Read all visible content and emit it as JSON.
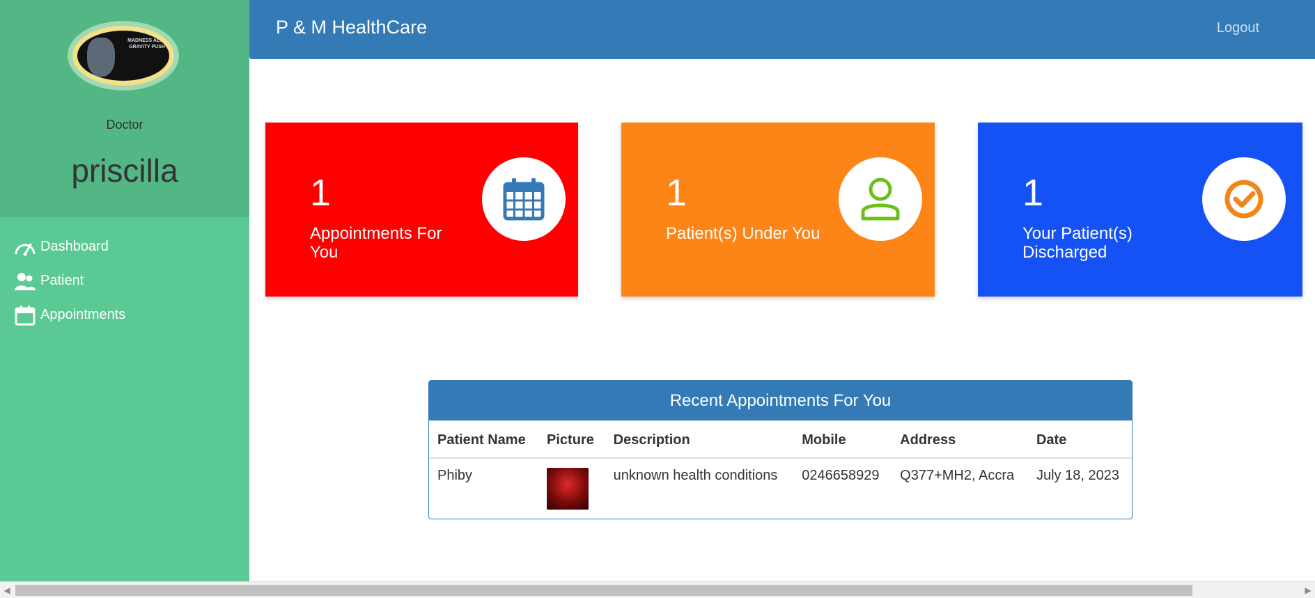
{
  "sidebar": {
    "role": "Doctor",
    "username": "priscilla",
    "avatar_text": "MADNESS ALOT GRAVITY PUSH",
    "items": [
      {
        "label": "Dashboard",
        "icon": "speedometer-icon"
      },
      {
        "label": "Patient",
        "icon": "users-icon"
      },
      {
        "label": "Appointments",
        "icon": "calendar-icon"
      }
    ]
  },
  "header": {
    "brand": "P & M HealthCare",
    "logout": "Logout"
  },
  "cards": [
    {
      "count": "1",
      "label": "Appointments For You",
      "color": "#ff0000",
      "icon": "calendar-icon",
      "icon_color": "#337ab7"
    },
    {
      "count": "1",
      "label": "Patient(s) Under You",
      "color": "#fd8416",
      "icon": "user-icon",
      "icon_color": "#6abf1a"
    },
    {
      "count": "1",
      "label": "Your Patient(s) Discharged",
      "color": "#1452f6",
      "icon": "check-circle-icon",
      "icon_color": "#f0861c"
    }
  ],
  "appointments": {
    "title": "Recent Appointments For You",
    "columns": [
      "Patient Name",
      "Picture",
      "Description",
      "Mobile",
      "Address",
      "Date"
    ],
    "rows": [
      {
        "name": "Phiby",
        "description": "unknown health conditions",
        "mobile": "0246658929",
        "address": "Q377+MH2, Accra",
        "date": "July 18, 2023"
      }
    ]
  },
  "colors": {
    "sidebar": "#5ac994",
    "profile": "#52b685",
    "header": "#337ab7"
  }
}
